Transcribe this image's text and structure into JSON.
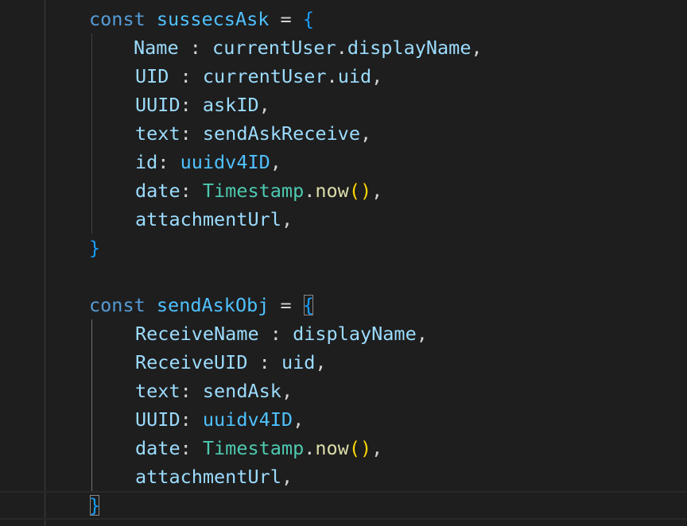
{
  "editor": {
    "language": "javascript",
    "colors": {
      "background": "#1e1e1e",
      "keyword": "#569cd6",
      "constant": "#4fc1ff",
      "variable": "#9cdcfe",
      "text": "#d4d4d4",
      "class": "#4ec9b0",
      "function": "#dcdcaa",
      "bracket_level1": "#ffd700",
      "bracket_level3": "#179fff"
    },
    "lines": [
      {
        "tokens": [
          {
            "t": "const",
            "c": "kw"
          },
          {
            "t": " ",
            "c": "plain"
          },
          {
            "t": "sussecsAsk",
            "c": "constv"
          },
          {
            "t": " = ",
            "c": "plain"
          },
          {
            "t": "{",
            "c": "brace3"
          }
        ]
      },
      {
        "tokens": [
          {
            "t": "Name",
            "c": "prop"
          },
          {
            "t": " : ",
            "c": "plain"
          },
          {
            "t": "currentUser",
            "c": "var"
          },
          {
            "t": ".",
            "c": "plain"
          },
          {
            "t": "displayName",
            "c": "prop"
          },
          {
            "t": ",",
            "c": "plain"
          }
        ]
      },
      {
        "tokens": [
          {
            "t": "UID",
            "c": "prop"
          },
          {
            "t": " : ",
            "c": "plain"
          },
          {
            "t": "currentUser",
            "c": "var"
          },
          {
            "t": ".",
            "c": "plain"
          },
          {
            "t": "uid",
            "c": "prop"
          },
          {
            "t": ",",
            "c": "plain"
          }
        ]
      },
      {
        "tokens": [
          {
            "t": "UUID",
            "c": "prop"
          },
          {
            "t": ": ",
            "c": "plain"
          },
          {
            "t": "askID",
            "c": "var"
          },
          {
            "t": ",",
            "c": "plain"
          }
        ]
      },
      {
        "tokens": [
          {
            "t": "text",
            "c": "prop"
          },
          {
            "t": ": ",
            "c": "plain"
          },
          {
            "t": "sendAskReceive",
            "c": "var"
          },
          {
            "t": ",",
            "c": "plain"
          }
        ]
      },
      {
        "tokens": [
          {
            "t": "id",
            "c": "prop"
          },
          {
            "t": ": ",
            "c": "plain"
          },
          {
            "t": "uuidv4ID",
            "c": "constv"
          },
          {
            "t": ",",
            "c": "plain"
          }
        ]
      },
      {
        "tokens": [
          {
            "t": "date",
            "c": "prop"
          },
          {
            "t": ": ",
            "c": "plain"
          },
          {
            "t": "Timestamp",
            "c": "cls"
          },
          {
            "t": ".",
            "c": "plain"
          },
          {
            "t": "now",
            "c": "fn"
          },
          {
            "t": "()",
            "c": "brace1"
          },
          {
            "t": ",",
            "c": "plain"
          }
        ]
      },
      {
        "tokens": [
          {
            "t": "attachmentUrl",
            "c": "prop"
          },
          {
            "t": ",",
            "c": "plain"
          }
        ]
      },
      {
        "tokens": [
          {
            "t": "}",
            "c": "brace3"
          }
        ]
      },
      {
        "tokens": []
      },
      {
        "tokens": [
          {
            "t": "const",
            "c": "kw"
          },
          {
            "t": " ",
            "c": "plain"
          },
          {
            "t": "sendAskObj",
            "c": "constv"
          },
          {
            "t": " = ",
            "c": "plain"
          },
          {
            "t": "{",
            "c": "brace3"
          }
        ]
      },
      {
        "tokens": [
          {
            "t": "ReceiveName",
            "c": "prop"
          },
          {
            "t": " : ",
            "c": "plain"
          },
          {
            "t": "displayName",
            "c": "var"
          },
          {
            "t": ",",
            "c": "plain"
          }
        ]
      },
      {
        "tokens": [
          {
            "t": "ReceiveUID",
            "c": "prop"
          },
          {
            "t": " : ",
            "c": "plain"
          },
          {
            "t": "uid",
            "c": "var"
          },
          {
            "t": ",",
            "c": "plain"
          }
        ]
      },
      {
        "tokens": [
          {
            "t": "text",
            "c": "prop"
          },
          {
            "t": ": ",
            "c": "plain"
          },
          {
            "t": "sendAsk",
            "c": "var"
          },
          {
            "t": ",",
            "c": "plain"
          }
        ]
      },
      {
        "tokens": [
          {
            "t": "UUID",
            "c": "prop"
          },
          {
            "t": ": ",
            "c": "plain"
          },
          {
            "t": "uuidv4ID",
            "c": "constv"
          },
          {
            "t": ",",
            "c": "plain"
          }
        ]
      },
      {
        "tokens": [
          {
            "t": "date",
            "c": "prop"
          },
          {
            "t": ": ",
            "c": "plain"
          },
          {
            "t": "Timestamp",
            "c": "cls"
          },
          {
            "t": ".",
            "c": "plain"
          },
          {
            "t": "now",
            "c": "fn"
          },
          {
            "t": "()",
            "c": "brace1"
          },
          {
            "t": ",",
            "c": "plain"
          }
        ]
      },
      {
        "tokens": [
          {
            "t": "attachmentUrl",
            "c": "prop"
          },
          {
            "t": ",",
            "c": "plain"
          }
        ]
      },
      {
        "tokens": [
          {
            "t": "}",
            "c": "brace3"
          }
        ]
      }
    ]
  }
}
